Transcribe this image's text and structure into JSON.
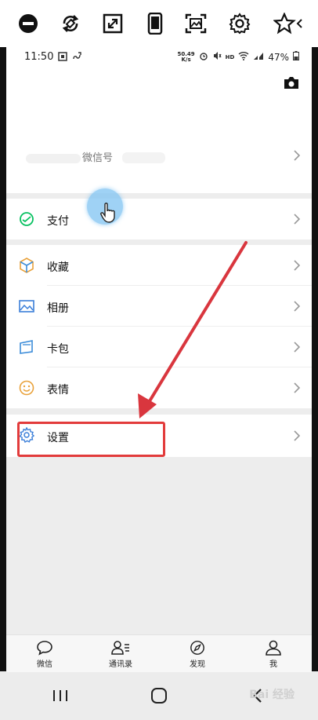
{
  "status": {
    "time": "11:50",
    "net_speed": "50.49",
    "net_unit": "K/s",
    "battery": "47%"
  },
  "profile": {
    "wechat_id_label": "微信号"
  },
  "menu": {
    "pay": "支付",
    "favorites": "收藏",
    "album": "相册",
    "cards": "卡包",
    "stickers": "表情",
    "settings": "设置"
  },
  "bottom_nav": [
    {
      "label": "微信",
      "icon": "chat-bubble-icon"
    },
    {
      "label": "通讯录",
      "icon": "contacts-icon"
    },
    {
      "label": "发现",
      "icon": "compass-icon"
    },
    {
      "label": "我",
      "icon": "person-icon"
    }
  ],
  "watermark": "Bai 经验",
  "colors": {
    "highlight_box": "#e23b3b",
    "arrow": "#d9363e",
    "touch_indicator": "#7fc3f2",
    "pay_icon": "#07c160"
  }
}
